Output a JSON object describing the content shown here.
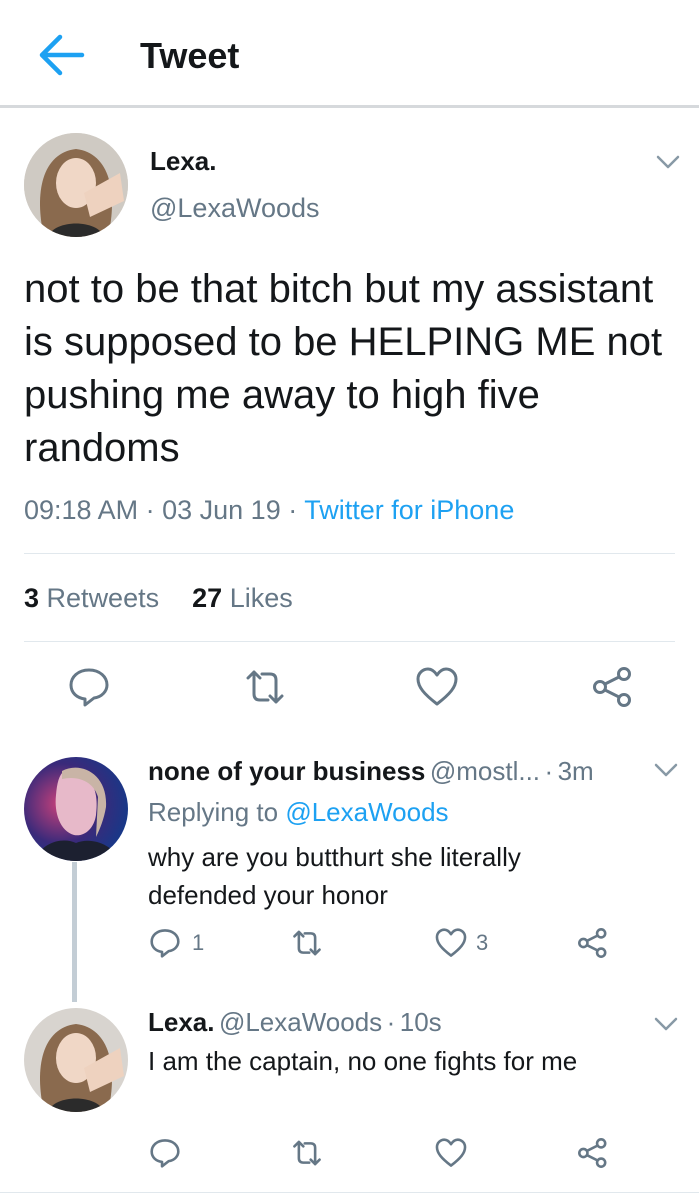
{
  "header": {
    "title": "Tweet"
  },
  "main_tweet": {
    "name": "Lexa.",
    "handle": "@LexaWoods",
    "text": "not to be that bitch but my assistant is supposed to be HELPING ME not pushing me away to high five randoms",
    "time": "09:18 AM",
    "date": "03 Jun 19",
    "source": "Twitter for iPhone",
    "separator": "·",
    "retweets_count": "3",
    "retweets_label": "Retweets",
    "likes_count": "27",
    "likes_label": "Likes"
  },
  "replies": [
    {
      "name": "none of your business",
      "handle": "@mostl...",
      "time": "3m",
      "separator": "·",
      "replying_prefix": "Replying to",
      "replying_to": "@LexaWoods",
      "text": "why are you butthurt she literally defended your honor",
      "reply_count": "1",
      "like_count": "3"
    },
    {
      "name": "Lexa.",
      "handle": "@LexaWoods",
      "time": "10s",
      "separator": "·",
      "text": "I am the captain, no one fights for me"
    }
  ],
  "icons": {
    "back": "back-arrow-icon",
    "menu": "chevron-down-icon",
    "reply": "reply-icon",
    "retweet": "retweet-icon",
    "like": "heart-icon",
    "share": "share-icon"
  },
  "colors": {
    "accent": "#1da1f2",
    "text": "#14171a",
    "secondary": "#657786",
    "divider": "#e1e8ed"
  }
}
